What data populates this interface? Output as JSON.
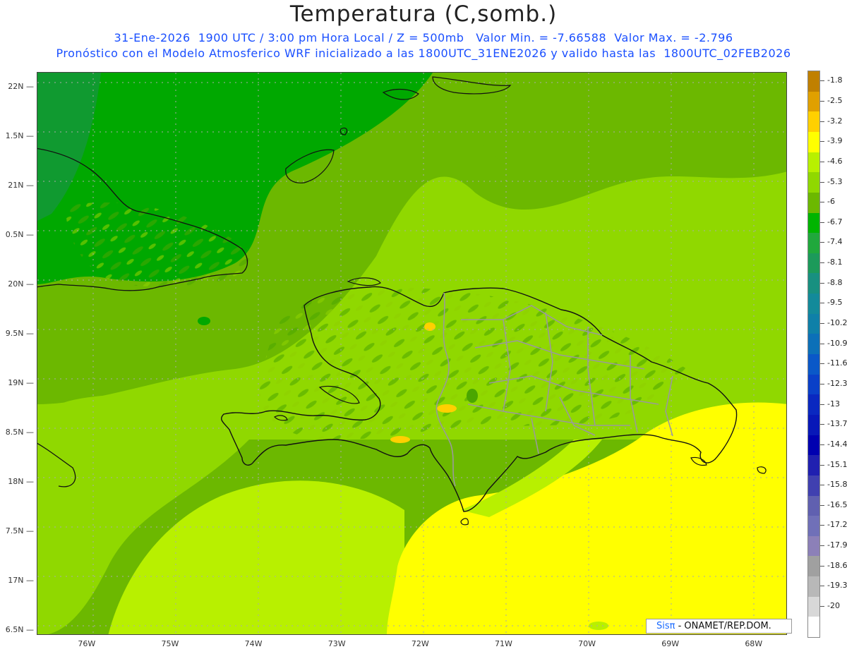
{
  "title": "Temperatura (C,somb.)",
  "subtitle_line1": "31-Ene-2026  1900 UTC / 3:00 pm Hora Local / Z = 500mb   Valor Min. = -7.66588  Valor Max. = -2.796",
  "subtitle_line2": "Pronóstico con el Modelo Atmosferico WRF inicializado a las 1800UTC_31ENE2026 y valido hasta las  1800UTC_02FEB2026",
  "credit": {
    "logo": "Sisπ",
    "org": " - ONAMET/REP.DOM."
  },
  "map": {
    "lon_range": [
      -76.6,
      -67.6
    ],
    "lat_range": [
      16.45,
      22.15
    ],
    "lat_labels": [
      {
        "lat": 22.0,
        "text": "22N"
      },
      {
        "lat": 21.5,
        "text": "1.5N"
      },
      {
        "lat": 21.0,
        "text": "21N"
      },
      {
        "lat": 20.5,
        "text": "0.5N"
      },
      {
        "lat": 20.0,
        "text": "20N"
      },
      {
        "lat": 19.5,
        "text": "9.5N"
      },
      {
        "lat": 19.0,
        "text": "19N"
      },
      {
        "lat": 18.5,
        "text": "8.5N"
      },
      {
        "lat": 18.0,
        "text": "18N"
      },
      {
        "lat": 17.5,
        "text": "7.5N"
      },
      {
        "lat": 17.0,
        "text": "17N"
      },
      {
        "lat": 16.5,
        "text": "6.5N"
      }
    ],
    "lon_labels": [
      {
        "lon": -76,
        "text": "76W"
      },
      {
        "lon": -75,
        "text": "75W"
      },
      {
        "lon": -74,
        "text": "74W"
      },
      {
        "lon": -73,
        "text": "73W"
      },
      {
        "lon": -72,
        "text": "72W"
      },
      {
        "lon": -71,
        "text": "71W"
      },
      {
        "lon": -70,
        "text": "70W"
      },
      {
        "lon": -69,
        "text": "69W"
      },
      {
        "lon": -68,
        "text": "68W"
      }
    ]
  },
  "colorbar": [
    {
      "label": "-1.8",
      "color": "#c08000"
    },
    {
      "label": "-2.5",
      "color": "#e0a000"
    },
    {
      "label": "-3.2",
      "color": "#ffd000"
    },
    {
      "label": "-3.9",
      "color": "#ffff00"
    },
    {
      "label": "-4.6",
      "color": "#b8f000"
    },
    {
      "label": "-5.3",
      "color": "#90d800"
    },
    {
      "label": "-6",
      "color": "#6cb800"
    },
    {
      "label": "-6.7",
      "color": "#00b400"
    },
    {
      "label": "-7.4",
      "color": "#20a83c"
    },
    {
      "label": "-8.1",
      "color": "#1c9a5a"
    },
    {
      "label": "-8.8",
      "color": "#189080"
    },
    {
      "label": "-9.5",
      "color": "#138a9a"
    },
    {
      "label": "-10.2",
      "color": "#0f80a8"
    },
    {
      "label": "-10.9",
      "color": "#0c70b8"
    },
    {
      "label": "-11.6",
      "color": "#0a58c8"
    },
    {
      "label": "-12.3",
      "color": "#0a40c8"
    },
    {
      "label": "-13",
      "color": "#0a28c0"
    },
    {
      "label": "-13.7",
      "color": "#0818b8"
    },
    {
      "label": "-14.4",
      "color": "#0000b0"
    },
    {
      "label": "-15.1",
      "color": "#2020b0"
    },
    {
      "label": "-15.8",
      "color": "#4040b0"
    },
    {
      "label": "-16.5",
      "color": "#6060b0"
    },
    {
      "label": "-17.2",
      "color": "#7070b8"
    },
    {
      "label": "-17.9",
      "color": "#8c80b8"
    },
    {
      "label": "-18.6",
      "color": "#a0a0a0"
    },
    {
      "label": "-19.3",
      "color": "#b8b8b8"
    },
    {
      "label": "-20",
      "color": "#d8d8d8"
    },
    {
      "label": "",
      "color": "#ffffff"
    }
  ]
}
